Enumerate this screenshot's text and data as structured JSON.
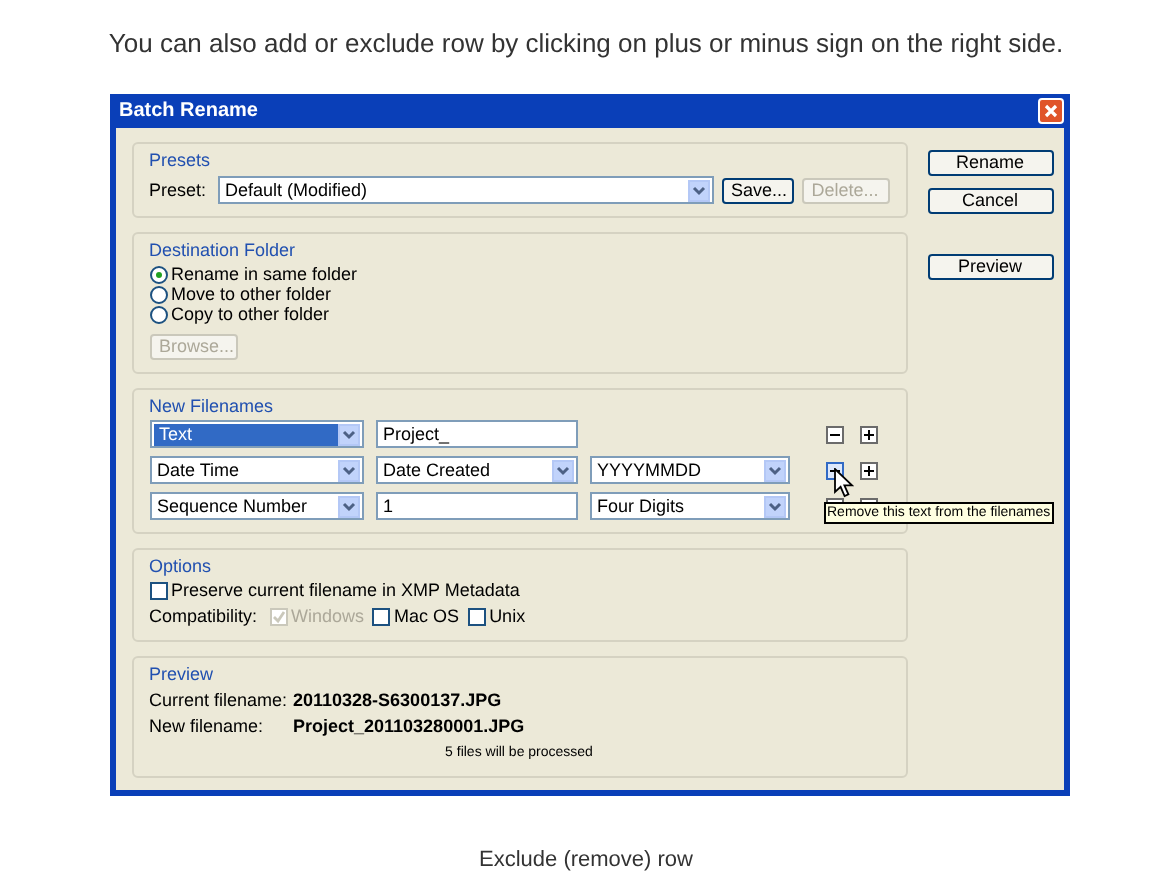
{
  "intro": "You can also add or exclude row by clicking on plus or minus sign on the right side.",
  "dialog": {
    "title": "Batch Rename",
    "presets": {
      "legend": "Presets",
      "label": "Preset:",
      "value": "Default (Modified)",
      "buttons": [
        {
          "label": "Save...",
          "disabled": false
        },
        {
          "label": "Delete...",
          "disabled": true
        }
      ]
    },
    "destination": {
      "legend": "Destination Folder",
      "options": [
        {
          "label": "Rename in same folder",
          "selected": true
        },
        {
          "label": "Move to other folder",
          "selected": false
        },
        {
          "label": "Copy to other folder",
          "selected": false
        }
      ],
      "browse": {
        "label": "Browse...",
        "disabled": true
      }
    },
    "new_filenames": {
      "legend": "New Filenames",
      "rows": [
        {
          "fields": [
            {
              "kind": "select",
              "value": "Text",
              "highlighted": true
            },
            {
              "kind": "input",
              "value": "Project_",
              "highlighted": false
            }
          ],
          "minus_hovered": false
        },
        {
          "fields": [
            {
              "kind": "select",
              "value": "Date Time",
              "highlighted": false
            },
            {
              "kind": "select",
              "value": "Date Created",
              "highlighted": false
            },
            {
              "kind": "select",
              "value": "YYYYMMDD",
              "highlighted": false
            }
          ],
          "minus_hovered": true
        },
        {
          "fields": [
            {
              "kind": "select",
              "value": "Sequence Number",
              "highlighted": false
            },
            {
              "kind": "input",
              "value": "1",
              "highlighted": false
            },
            {
              "kind": "select",
              "value": "Four Digits",
              "highlighted": false
            }
          ],
          "minus_hovered": false
        }
      ],
      "tooltip": "Remove this text from the filenames"
    },
    "options": {
      "legend": "Options",
      "preserve": {
        "label": "Preserve current filename in XMP Metadata",
        "checked": false
      },
      "compat_label": "Compatibility:",
      "compat": [
        {
          "label": "Windows",
          "checked": true,
          "disabled": true
        },
        {
          "label": "Mac OS",
          "checked": false,
          "disabled": false
        },
        {
          "label": "Unix",
          "checked": false,
          "disabled": false
        }
      ]
    },
    "preview": {
      "legend": "Preview",
      "rows": [
        {
          "label": "Current filename:",
          "value": "20110328-S6300137.JPG"
        },
        {
          "label": "New filename:",
          "value": "Project_201103280001.JPG"
        }
      ],
      "note": "5 files will be processed"
    },
    "side_buttons": [
      "Rename",
      "Cancel",
      "Preview"
    ]
  },
  "caption": "Exclude (remove) row"
}
